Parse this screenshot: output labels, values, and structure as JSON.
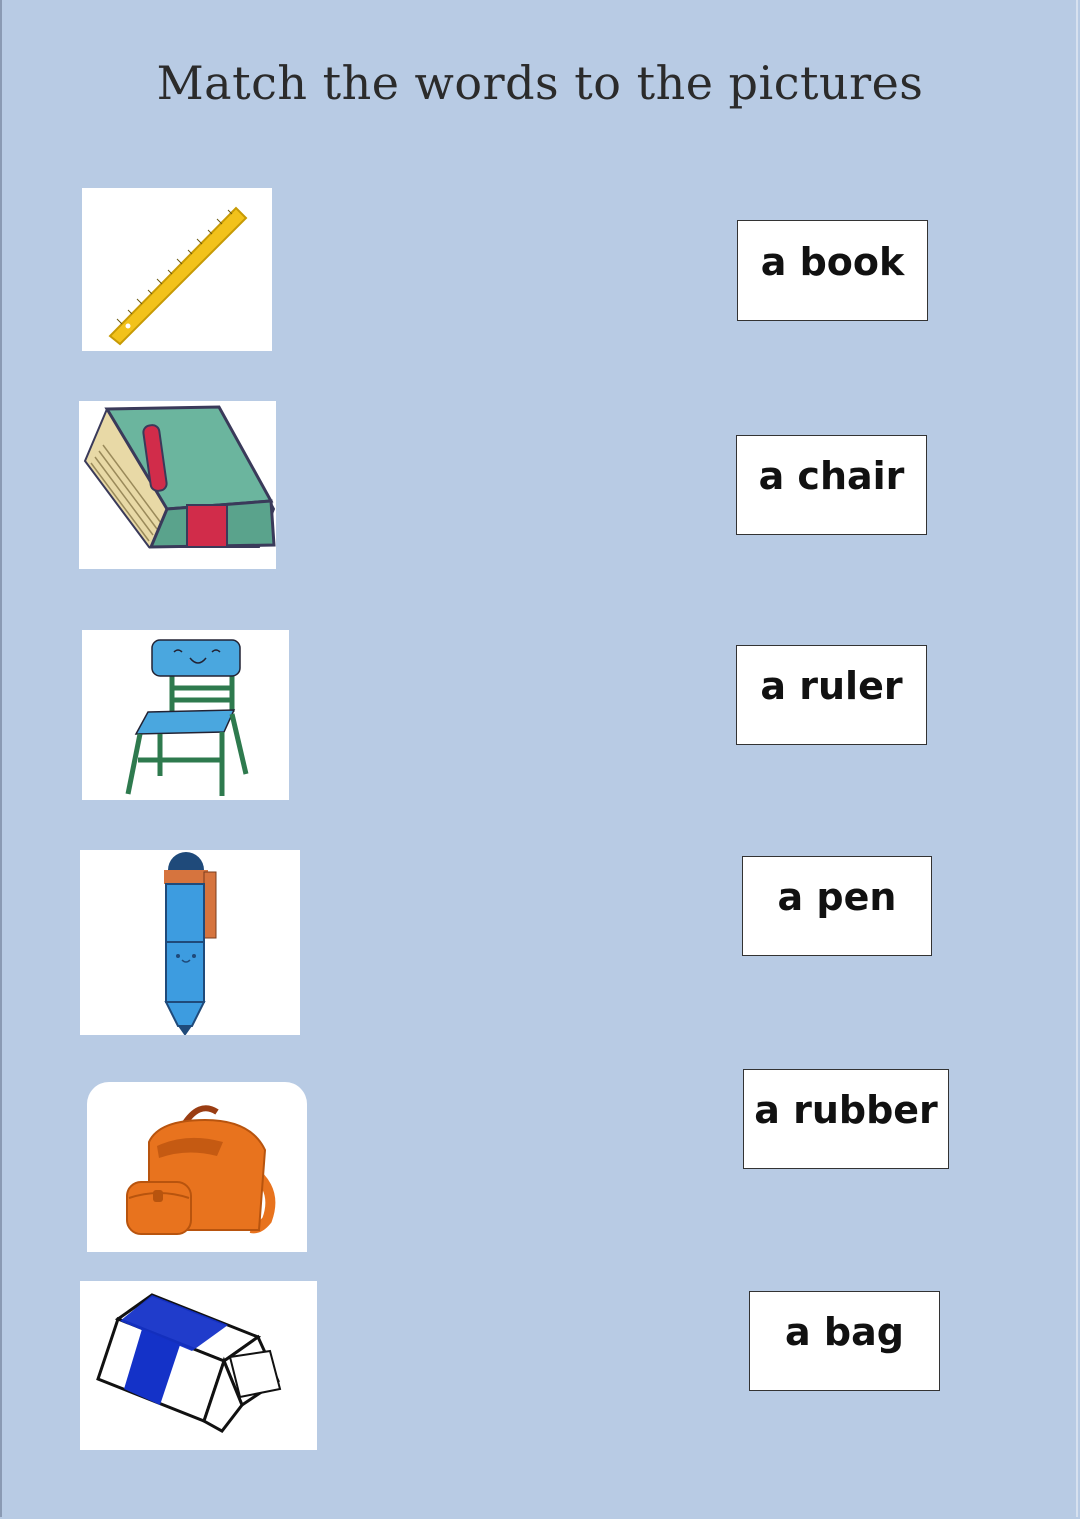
{
  "title": "Match the words to the pictures",
  "words": [
    "a book",
    "a chair",
    "a ruler",
    "a pen",
    "a rubber",
    "a bag"
  ],
  "pictures": [
    "ruler-icon",
    "book-icon",
    "chair-icon",
    "pen-icon",
    "bag-icon",
    "rubber-icon"
  ],
  "colors": {
    "background": "#b8cbe4",
    "ruler": "#f2c21b",
    "book": "#6bb59e",
    "chair_seat": "#4aa7df",
    "pen": "#3d9ce0",
    "bag": "#e8731e",
    "rubber": "#1432c8"
  }
}
